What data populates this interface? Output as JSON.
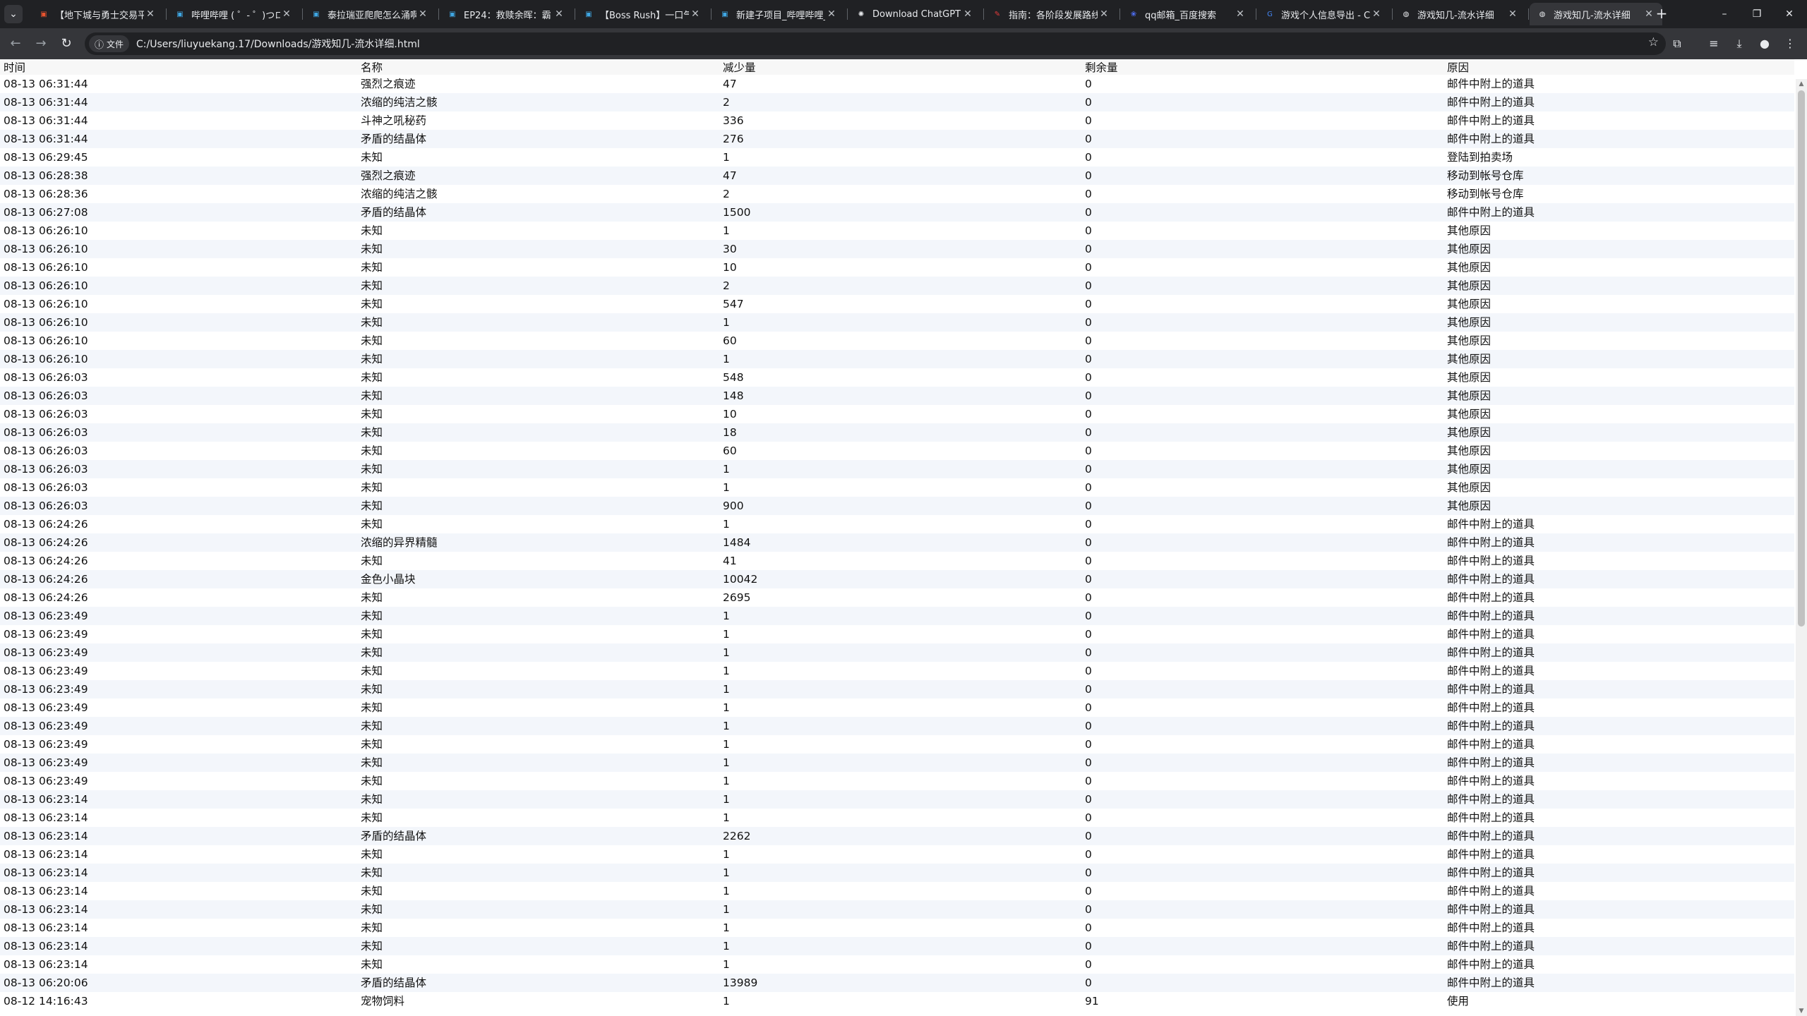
{
  "browser": {
    "tabs": [
      {
        "title": "【地下城与勇士交易平",
        "favicon": "tv-icon",
        "fav_color": "#e8542f"
      },
      {
        "title": "哔哩哔哩 ( ゜- ゜)つロ",
        "favicon": "tv-icon",
        "fav_color": "#3fa7e3"
      },
      {
        "title": "泰拉瑞亚爬爬怎么涌啊",
        "favicon": "tv-icon",
        "fav_color": "#3fa7e3"
      },
      {
        "title": "EP24：救赎余晖：霸",
        "favicon": "tv-icon",
        "fav_color": "#3fa7e3"
      },
      {
        "title": "【Boss Rush】一口气",
        "favicon": "tv-icon",
        "fav_color": "#3fa7e3"
      },
      {
        "title": "新建子项目_哔哩哔哩_",
        "favicon": "tv-icon",
        "fav_color": "#3fa7e3"
      },
      {
        "title": "Download ChatGPT",
        "favicon": "openai-icon",
        "fav_color": "#e8eaed"
      },
      {
        "title": "指南：各阶段发展路线",
        "favicon": "feather-icon",
        "fav_color": "#e83b3b"
      },
      {
        "title": "qq邮箱_百度搜索",
        "favicon": "paw-icon",
        "fav_color": "#4e6ef2"
      },
      {
        "title": "游戏个人信息导出 - C",
        "favicon": "google-icon",
        "fav_color": "#4285f4"
      },
      {
        "title": "游戏知几-流水详细",
        "favicon": "globe-icon",
        "fav_color": "#e8eaed"
      },
      {
        "title": "游戏知几-流水详细",
        "favicon": "globe-icon",
        "fav_color": "#e8eaed"
      }
    ],
    "new_tab": "+",
    "window_controls": {
      "minimize": "–",
      "maximize": "❐",
      "close": "✕"
    },
    "url_chip": "文件",
    "url": "C:/Users/liuyuekang.17/Downloads/游戏知几-流水详细.html"
  },
  "table": {
    "headers": [
      "时间",
      "名称",
      "减少量",
      "剩余量",
      "原因"
    ],
    "rows": [
      [
        "08-13 06:31:44",
        "强烈之痕迹",
        "47",
        "0",
        "邮件中附上的道具"
      ],
      [
        "08-13 06:31:44",
        "浓缩的纯洁之骸",
        "2",
        "0",
        "邮件中附上的道具"
      ],
      [
        "08-13 06:31:44",
        "斗神之吼秘药",
        "336",
        "0",
        "邮件中附上的道具"
      ],
      [
        "08-13 06:31:44",
        "矛盾的结晶体",
        "276",
        "0",
        "邮件中附上的道具"
      ],
      [
        "08-13 06:29:45",
        "未知",
        "1",
        "0",
        "登陆到拍卖场"
      ],
      [
        "08-13 06:28:38",
        "强烈之痕迹",
        "47",
        "0",
        "移动到帐号仓库"
      ],
      [
        "08-13 06:28:36",
        "浓缩的纯洁之骸",
        "2",
        "0",
        "移动到帐号仓库"
      ],
      [
        "08-13 06:27:08",
        "矛盾的结晶体",
        "1500",
        "0",
        "邮件中附上的道具"
      ],
      [
        "08-13 06:26:10",
        "未知",
        "1",
        "0",
        "其他原因"
      ],
      [
        "08-13 06:26:10",
        "未知",
        "30",
        "0",
        "其他原因"
      ],
      [
        "08-13 06:26:10",
        "未知",
        "10",
        "0",
        "其他原因"
      ],
      [
        "08-13 06:26:10",
        "未知",
        "2",
        "0",
        "其他原因"
      ],
      [
        "08-13 06:26:10",
        "未知",
        "547",
        "0",
        "其他原因"
      ],
      [
        "08-13 06:26:10",
        "未知",
        "1",
        "0",
        "其他原因"
      ],
      [
        "08-13 06:26:10",
        "未知",
        "60",
        "0",
        "其他原因"
      ],
      [
        "08-13 06:26:10",
        "未知",
        "1",
        "0",
        "其他原因"
      ],
      [
        "08-13 06:26:03",
        "未知",
        "548",
        "0",
        "其他原因"
      ],
      [
        "08-13 06:26:03",
        "未知",
        "148",
        "0",
        "其他原因"
      ],
      [
        "08-13 06:26:03",
        "未知",
        "10",
        "0",
        "其他原因"
      ],
      [
        "08-13 06:26:03",
        "未知",
        "18",
        "0",
        "其他原因"
      ],
      [
        "08-13 06:26:03",
        "未知",
        "60",
        "0",
        "其他原因"
      ],
      [
        "08-13 06:26:03",
        "未知",
        "1",
        "0",
        "其他原因"
      ],
      [
        "08-13 06:26:03",
        "未知",
        "1",
        "0",
        "其他原因"
      ],
      [
        "08-13 06:26:03",
        "未知",
        "900",
        "0",
        "其他原因"
      ],
      [
        "08-13 06:24:26",
        "未知",
        "1",
        "0",
        "邮件中附上的道具"
      ],
      [
        "08-13 06:24:26",
        "浓缩的异界精髓",
        "1484",
        "0",
        "邮件中附上的道具"
      ],
      [
        "08-13 06:24:26",
        "未知",
        "41",
        "0",
        "邮件中附上的道具"
      ],
      [
        "08-13 06:24:26",
        "金色小晶块",
        "10042",
        "0",
        "邮件中附上的道具"
      ],
      [
        "08-13 06:24:26",
        "未知",
        "2695",
        "0",
        "邮件中附上的道具"
      ],
      [
        "08-13 06:23:49",
        "未知",
        "1",
        "0",
        "邮件中附上的道具"
      ],
      [
        "08-13 06:23:49",
        "未知",
        "1",
        "0",
        "邮件中附上的道具"
      ],
      [
        "08-13 06:23:49",
        "未知",
        "1",
        "0",
        "邮件中附上的道具"
      ],
      [
        "08-13 06:23:49",
        "未知",
        "1",
        "0",
        "邮件中附上的道具"
      ],
      [
        "08-13 06:23:49",
        "未知",
        "1",
        "0",
        "邮件中附上的道具"
      ],
      [
        "08-13 06:23:49",
        "未知",
        "1",
        "0",
        "邮件中附上的道具"
      ],
      [
        "08-13 06:23:49",
        "未知",
        "1",
        "0",
        "邮件中附上的道具"
      ],
      [
        "08-13 06:23:49",
        "未知",
        "1",
        "0",
        "邮件中附上的道具"
      ],
      [
        "08-13 06:23:49",
        "未知",
        "1",
        "0",
        "邮件中附上的道具"
      ],
      [
        "08-13 06:23:49",
        "未知",
        "1",
        "0",
        "邮件中附上的道具"
      ],
      [
        "08-13 06:23:14",
        "未知",
        "1",
        "0",
        "邮件中附上的道具"
      ],
      [
        "08-13 06:23:14",
        "未知",
        "1",
        "0",
        "邮件中附上的道具"
      ],
      [
        "08-13 06:23:14",
        "矛盾的结晶体",
        "2262",
        "0",
        "邮件中附上的道具"
      ],
      [
        "08-13 06:23:14",
        "未知",
        "1",
        "0",
        "邮件中附上的道具"
      ],
      [
        "08-13 06:23:14",
        "未知",
        "1",
        "0",
        "邮件中附上的道具"
      ],
      [
        "08-13 06:23:14",
        "未知",
        "1",
        "0",
        "邮件中附上的道具"
      ],
      [
        "08-13 06:23:14",
        "未知",
        "1",
        "0",
        "邮件中附上的道具"
      ],
      [
        "08-13 06:23:14",
        "未知",
        "1",
        "0",
        "邮件中附上的道具"
      ],
      [
        "08-13 06:23:14",
        "未知",
        "1",
        "0",
        "邮件中附上的道具"
      ],
      [
        "08-13 06:23:14",
        "未知",
        "1",
        "0",
        "邮件中附上的道具"
      ],
      [
        "08-13 06:20:06",
        "矛盾的结晶体",
        "13989",
        "0",
        "邮件中附上的道具"
      ],
      [
        "08-12 14:16:43",
        "宠物饲料",
        "1",
        "91",
        "使用"
      ]
    ]
  }
}
